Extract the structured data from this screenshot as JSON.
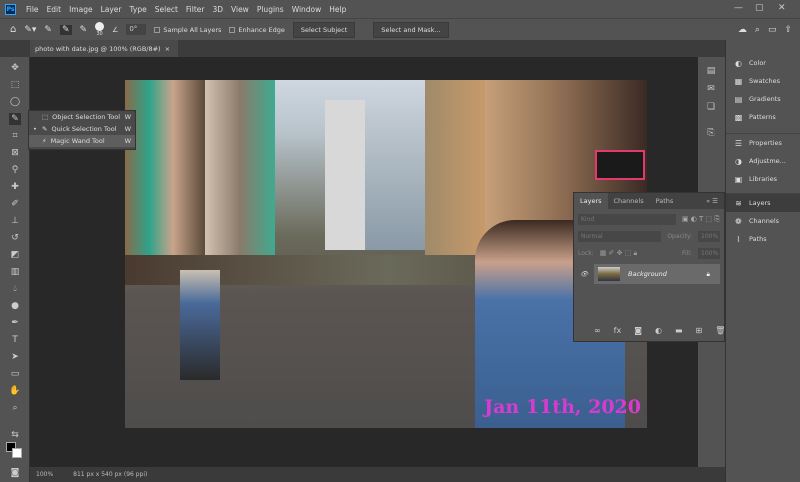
{
  "menubar": {
    "logo": "Ps",
    "items": [
      "File",
      "Edit",
      "Image",
      "Layer",
      "Type",
      "Select",
      "Filter",
      "3D",
      "View",
      "Plugins",
      "Window",
      "Help"
    ],
    "window_controls": [
      "—",
      "▢",
      "✕"
    ]
  },
  "options": {
    "brush_size": "30",
    "angle": "0°",
    "sample_all_layers": "Sample All Layers",
    "enhance_edge": "Enhance Edge",
    "select_subject": "Select Subject",
    "select_and_mask": "Select and Mask..."
  },
  "document": {
    "tab_title": "photo with date.jpg @ 100% (RGB/8#)",
    "close": "×",
    "date_overlay": "Jan 11th, 2020"
  },
  "flyout": [
    {
      "label": "Object Selection Tool",
      "key": "W",
      "active": false
    },
    {
      "label": "Quick Selection Tool",
      "key": "W",
      "active": true
    },
    {
      "label": "Magic Wand Tool",
      "key": "W",
      "active": false
    }
  ],
  "status": {
    "zoom": "100%",
    "doc_info": "811 px x 540 px (96 ppi)"
  },
  "right_panel": {
    "items": [
      {
        "label": "Color",
        "icon": "◐"
      },
      {
        "label": "Swatches",
        "icon": "▦"
      },
      {
        "label": "Gradients",
        "icon": "▤"
      },
      {
        "label": "Patterns",
        "icon": "▩"
      },
      {
        "label": "Properties",
        "icon": "☰"
      },
      {
        "label": "Adjustme...",
        "icon": "◑"
      },
      {
        "label": "Libraries",
        "icon": "▣"
      },
      {
        "label": "Layers",
        "icon": "≋"
      },
      {
        "label": "Channels",
        "icon": "❁"
      },
      {
        "label": "Paths",
        "icon": "⌇"
      }
    ]
  },
  "layers_panel": {
    "tabs": [
      "Layers",
      "Channels",
      "Paths"
    ],
    "filter": "Kind",
    "blend_mode": "Normal",
    "opacity_label": "Opacity:",
    "opacity": "100%",
    "lock_label": "Lock:",
    "fill_label": "Fill:",
    "fill": "100%",
    "layer_name": "Background"
  },
  "colors": {
    "date_text": "#d93bd0",
    "ui_bg": "#535353",
    "canvas_bg": "#282828"
  }
}
